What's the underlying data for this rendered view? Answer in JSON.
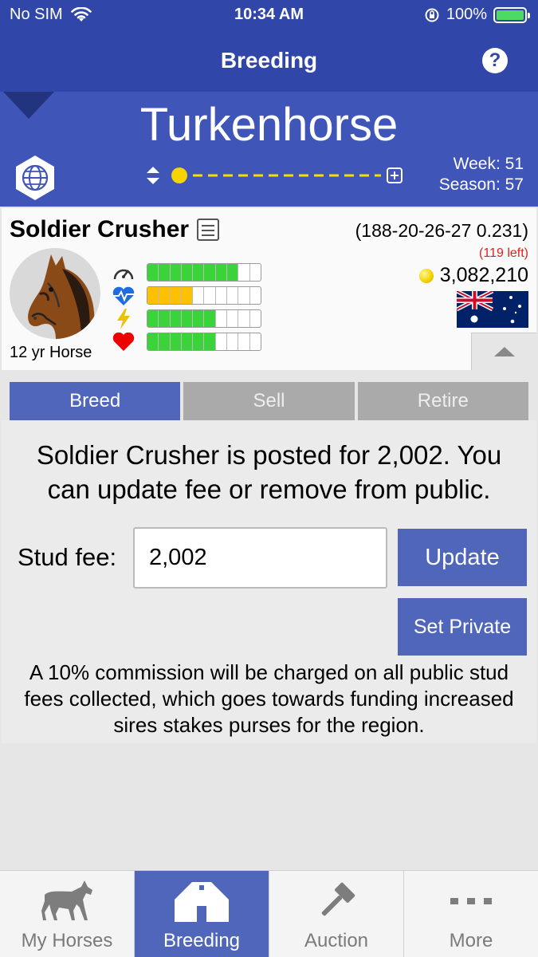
{
  "status_bar": {
    "carrier": "No SIM",
    "time": "10:34 AM",
    "battery": "100%"
  },
  "nav": {
    "title": "Breeding",
    "help_icon": "question-icon"
  },
  "header": {
    "stable_name": "Turkenhorse",
    "week": "Week: 51",
    "season": "Season: 57"
  },
  "horse": {
    "name": "Soldier Crusher",
    "record": "(188-20-26-27 0.231)",
    "left": "(119 left)",
    "money": "3,082,210",
    "age": "12 yr Horse",
    "flag": "australia-flag",
    "stats": [
      {
        "icon": "speedometer-icon",
        "fill": 0.8,
        "color": "#3ad43a"
      },
      {
        "icon": "heartbeat-icon",
        "fill": 0.43,
        "color": "#ffc000"
      },
      {
        "icon": "lightning-icon",
        "fill": 0.67,
        "color": "#3ad43a"
      },
      {
        "icon": "heart-icon",
        "fill": 0.6,
        "color": "#3ad43a"
      }
    ]
  },
  "tabs": {
    "breed": "Breed",
    "sell": "Sell",
    "retire": "Retire",
    "active": "breed"
  },
  "content": {
    "message": "Soldier Crusher is posted for 2,002. You can update fee or remove from public.",
    "fee_label": "Stud fee:",
    "fee_value": "2,002",
    "update_label": "Update",
    "private_label": "Set Private",
    "note": "A 10% commission will be charged on all public stud fees collected, which goes towards funding increased sires stakes purses for the region."
  },
  "tabbar": {
    "items": [
      {
        "label": "My Horses",
        "icon": "horse-icon"
      },
      {
        "label": "Breeding",
        "icon": "barn-icon"
      },
      {
        "label": "Auction",
        "icon": "gavel-icon"
      },
      {
        "label": "More",
        "icon": "more-icon"
      }
    ],
    "active": "Breeding"
  },
  "colors": {
    "nav": "#3046a8",
    "band": "#3f55b8",
    "accent": "#4f66bb"
  }
}
